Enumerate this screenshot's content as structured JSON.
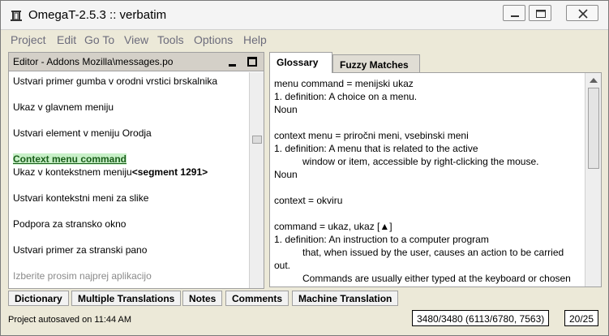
{
  "window": {
    "title": "OmegaT-2.5.3 :: verbatim"
  },
  "menu": [
    {
      "label": "Project",
      "name": "menu-project"
    },
    {
      "label": "Edit",
      "name": "menu-edit"
    },
    {
      "label": "Go To",
      "name": "menu-goto"
    },
    {
      "label": "View",
      "name": "menu-view"
    },
    {
      "label": "Tools",
      "name": "menu-tools"
    },
    {
      "label": "Options",
      "name": "menu-options"
    },
    {
      "label": "Help",
      "name": "menu-help"
    }
  ],
  "editor": {
    "title": "Editor - Addons Mozilla\\messages.po",
    "segments": [
      "Ustvari primer gumba v orodni vrstici brskalnika",
      "Ukaz v glavnem meniju",
      "Ustvari element v meniju Orodja",
      "Context menu command",
      "Ukaz v kontekstnem meniju",
      "<segment 1291>",
      "Ustvari kontekstni meni za slike",
      "Podpora za stransko okno",
      "Ustvari primer za stranski pano",
      "Izberite prosim najprej aplikacijo"
    ]
  },
  "tabs": {
    "glossary": "Glossary",
    "fuzzy": "Fuzzy Matches"
  },
  "glossary": {
    "lines": [
      "menu command = menijski ukaz",
      "1. definition: A choice on a menu.",
      "Noun",
      "",
      "context menu = priročni meni, vsebinski meni",
      "1. definition: A menu that is related to the active",
      "window or item, accessible by right-clicking the mouse.",
      "Noun",
      "",
      "context  = okviru",
      "",
      "command = ukaz, ukaz [▲]",
      "1. definition: An instruction to a computer program",
      "that, when issued by the user, causes an action to be carried",
      "out.",
      "Commands are usually either typed at the keyboard or chosen"
    ]
  },
  "bottom_tabs": [
    {
      "label": "Dictionary",
      "name": "tab-dictionary"
    },
    {
      "label": "Multiple Translations",
      "name": "tab-multiple-translations"
    },
    {
      "label": "Notes",
      "name": "tab-notes"
    },
    {
      "label": "Comments",
      "name": "tab-comments"
    },
    {
      "label": "Machine Translation",
      "name": "tab-machine-translation"
    }
  ],
  "status": {
    "message": "Project autosaved on 11:44 AM",
    "progress": "3480/3480 (6113/6780, 7563)",
    "segment_count": "20/25"
  }
}
